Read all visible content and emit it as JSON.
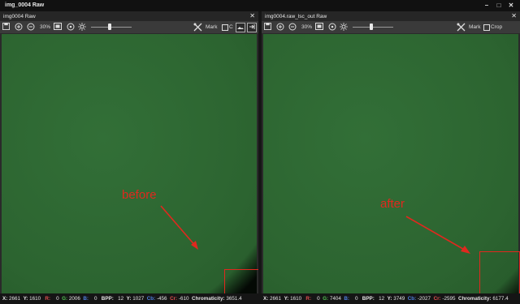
{
  "window": {
    "title": "img_0004 Raw",
    "min": "–",
    "max": "□",
    "close": "✕"
  },
  "left": {
    "tab": "img0004 Raw",
    "close": "✕",
    "zoom": "30%",
    "mark": "Mark",
    "crop_partial": "C",
    "annotation": "before"
  },
  "right": {
    "tab": "img0004.raw_lsc_out Raw",
    "close": "✕",
    "zoom": "30%",
    "mark": "Mark",
    "crop": "Crop",
    "annotation": "after"
  },
  "status_left": {
    "x_label": "X:",
    "x": "2661",
    "y_label": "Y:",
    "y": "1610",
    "r_label": "R:",
    "r": "0",
    "g_label": "G:",
    "g": "2006",
    "b_label": "B:",
    "b": "0",
    "bpp_label": "BPP:",
    "bpp": "12",
    "y2_label": "Y:",
    "y2": "1027",
    "cb_label": "Cb:",
    "cb": "-456",
    "cr_label": "Cr:",
    "cr": "-610",
    "chroma_label": "Chromaticity:",
    "chroma": "3651.4"
  },
  "status_right": {
    "x_label": "X:",
    "x": "2661",
    "y_label": "Y:",
    "y": "1610",
    "r_label": "R:",
    "r": "0",
    "g_label": "G:",
    "g": "7404",
    "b_label": "B:",
    "b": "0",
    "bpp_label": "BPP:",
    "bpp": "12",
    "y2_label": "Y:",
    "y2": "3749",
    "cb_label": "Cb:",
    "cb": "-2027",
    "cr_label": "Cr:",
    "cr": "-2595",
    "chroma_label": "Chromaticity:",
    "chroma": "6177.4"
  },
  "colors": {
    "accent_red": "#e0281e",
    "image_green": "#2f6b34",
    "r_text": "#e05050",
    "g_text": "#50c050",
    "b_text": "#5080e0"
  },
  "icons": [
    "save-icon",
    "zoom-in-icon",
    "zoom-out-icon",
    "fit-icon",
    "zoom-reset-icon",
    "brightness-icon",
    "tools-icon",
    "image-icon",
    "exit-icon"
  ]
}
